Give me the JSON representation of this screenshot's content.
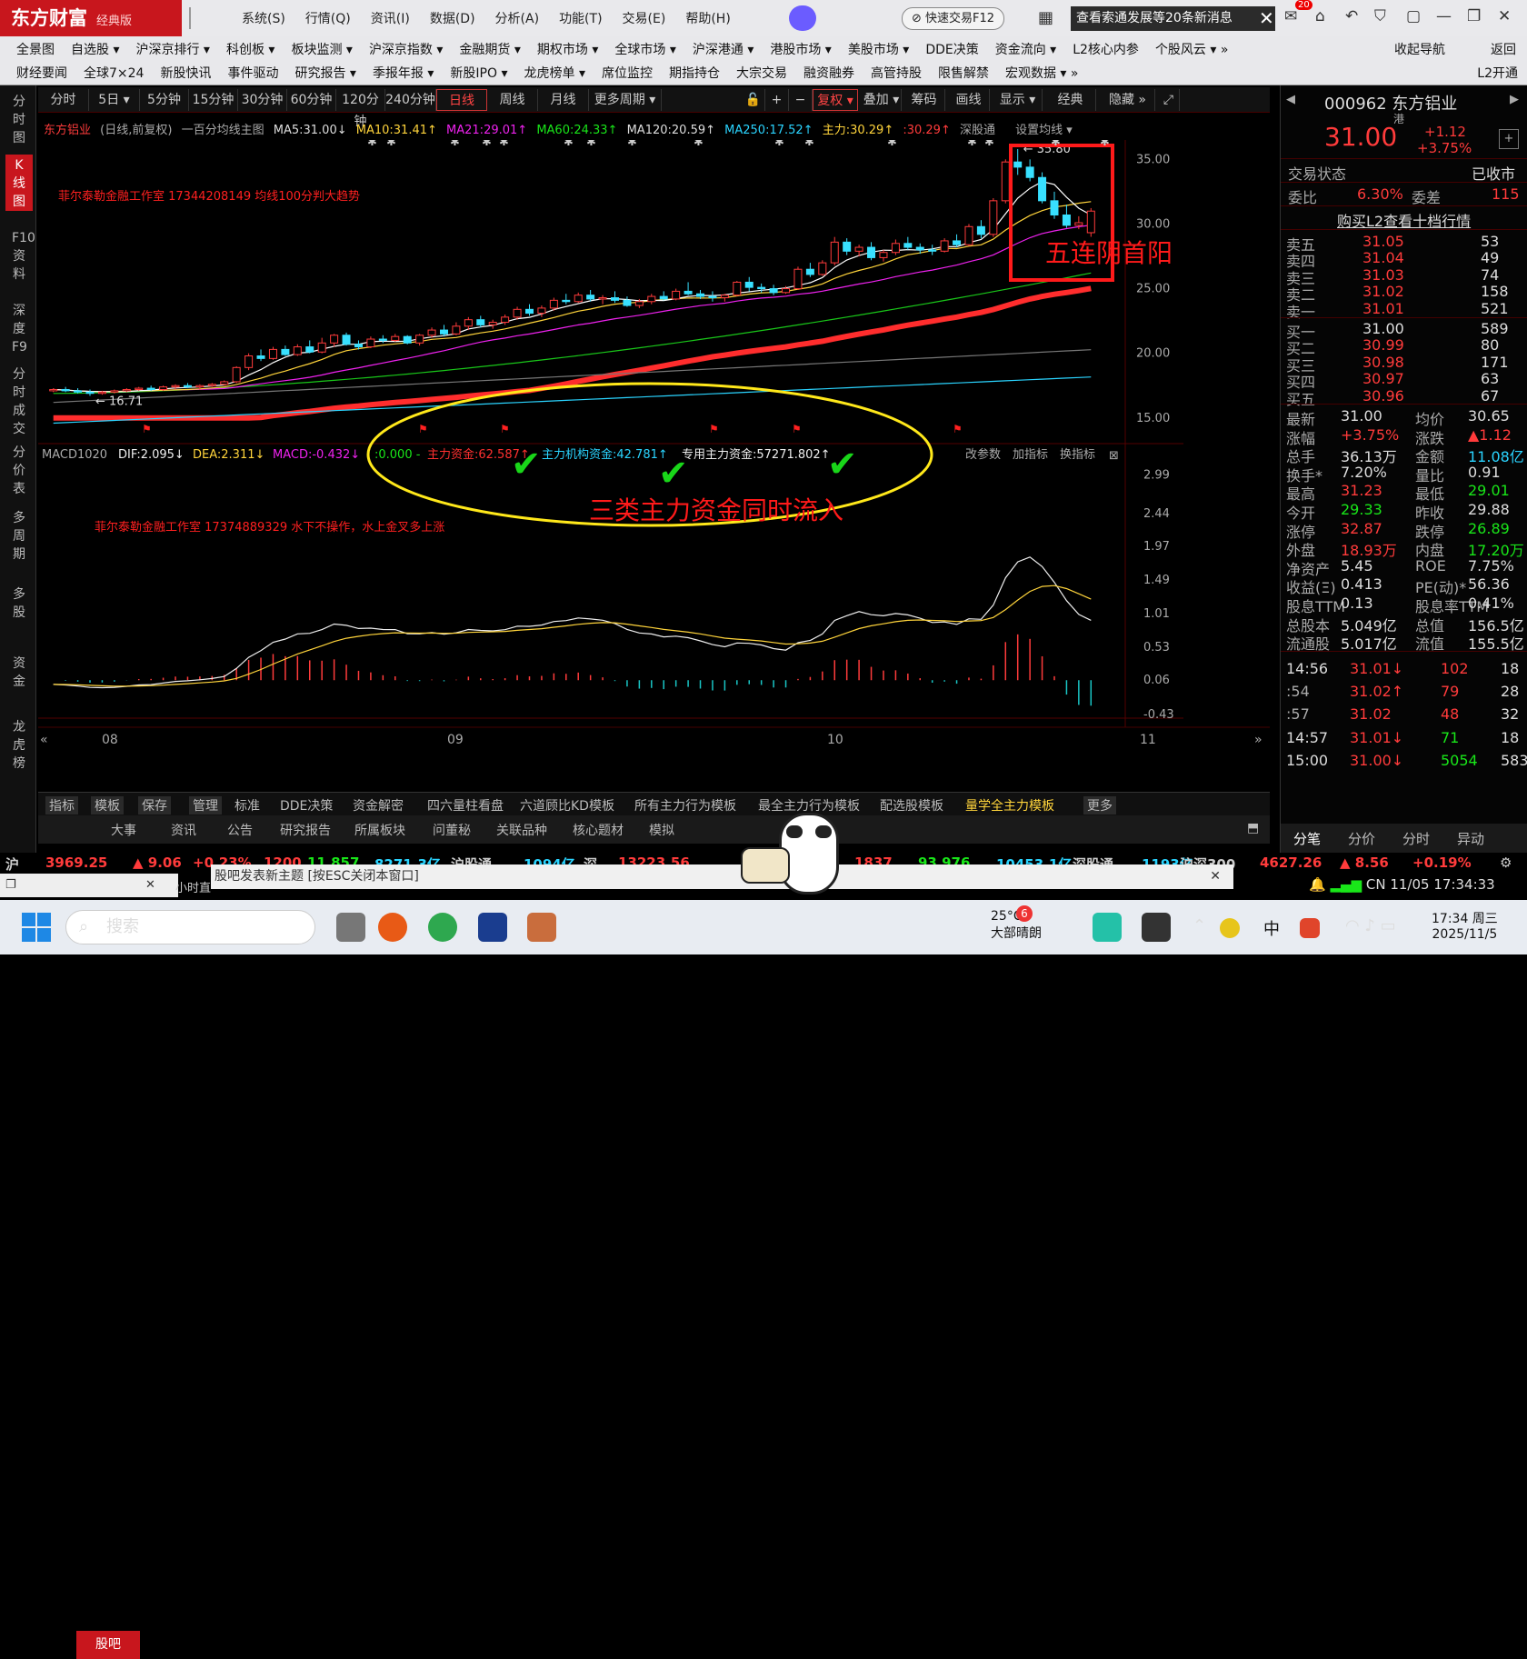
{
  "app": {
    "logo": "东方财富",
    "edition": "经典版"
  },
  "menu": [
    "系统(S)",
    "行情(Q)",
    "资讯(I)",
    "数据(D)",
    "分析(A)",
    "功能(T)",
    "交易(E)",
    "帮助(H)"
  ],
  "fast_trade": "快速交易F12",
  "notice": "查看索通发展等20条新消息",
  "mail_badge": "20",
  "nav1": [
    "全景图",
    "自选股 ▾",
    "沪深京排行 ▾",
    "科创板 ▾",
    "板块监测 ▾",
    "沪深京指数 ▾",
    "金融期货 ▾",
    "期权市场 ▾",
    "全球市场 ▾",
    "沪深港通 ▾",
    "港股市场 ▾",
    "美股市场 ▾",
    "DDE决策",
    "资金流向 ▾",
    "L2核心内参",
    "个股风云 ▾ »"
  ],
  "nav1_right": [
    "收起导航",
    "返回"
  ],
  "nav2": [
    "财经要闻",
    "全球7×24",
    "新股快讯",
    "事件驱动",
    "研究报告 ▾",
    "季报年报 ▾",
    "新股IPO ▾",
    "龙虎榜单 ▾",
    "席位监控",
    "期指持仓",
    "大宗交易",
    "融资融券",
    "高管持股",
    "限售解禁",
    "宏观数据 ▾ »"
  ],
  "nav2_right": "L2开通",
  "left_tabs": [
    "分时图",
    "K线图",
    "F10资料",
    "深度F9",
    "分时成交",
    "分价表",
    "多周期",
    "多股",
    "资金",
    "龙虎榜"
  ],
  "periods": [
    "分时",
    "5日 ▾",
    "5分钟",
    "15分钟",
    "30分钟",
    "60分钟",
    "120分钟",
    "240分钟",
    "日线",
    "周线",
    "月线",
    "更多周期 ▾"
  ],
  "tools": [
    "复权 ▾",
    "叠加 ▾",
    "筹码",
    "画线",
    "显示 ▾",
    "经典",
    "隐藏 »"
  ],
  "info": {
    "name": "东方铝业",
    "mode": "(日线,前复权)",
    "main": "一百分均线主图",
    "ma5": "MA5:31.00↓",
    "ma10": "MA10:31.41↑",
    "ma21": "MA21:29.01↑",
    "ma60": "MA60:24.33↑",
    "ma120": "MA120:20.59↑",
    "ma250": "MA250:17.52↑",
    "zl1": "主力:30.29↑",
    "zl2": ":30.29↑",
    "link": "深股通",
    "set": "设置均线 ▾"
  },
  "annot": {
    "top": "菲尔泰勒金融工作室 17344208149 均线100分判大趋势",
    "five": "五连阴首阳",
    "max": "35.80",
    "min": "16.71",
    "macd_note": "菲尔泰勒金融工作室 17374889329 水下不操作，水上金叉多上涨",
    "three": "三类主力资金同时流入"
  },
  "macd": {
    "name": "MACD1020",
    "dif": "DIF:2.095↓",
    "dea": "DEA:2.311↓",
    "macd": "MACD:-0.432↓",
    "zero": ":0.000 -",
    "f1": "主力资金:62.587↑",
    "f2": "主力机构资金:42.781↑",
    "f3": "专用主力资金:57271.802↑",
    "btns": [
      "改参数",
      "加指标",
      "换指标"
    ]
  },
  "price_axis": [
    "35.00",
    "30.00",
    "25.00",
    "20.00",
    "15.00"
  ],
  "macd_axis": [
    "2.99",
    "2.44",
    "1.97",
    "1.49",
    "1.01",
    "0.53",
    "0.06",
    "-0.43"
  ],
  "months": [
    "08",
    "09",
    "10",
    "11"
  ],
  "bot1": [
    "指标",
    "模板",
    "保存",
    "管理",
    "标准",
    "DDE决策",
    "资金解密",
    "四六量柱看盘",
    "六道顾比KD模板",
    "所有主力行为模板",
    "最全主力行为模板",
    "配选股模板",
    "量学全主力模板",
    "更多"
  ],
  "bot2": [
    "股吧",
    "大事",
    "资讯",
    "公告",
    "研究报告",
    "所属板块",
    "问董秘",
    "关联品种",
    "核心题材",
    "模拟"
  ],
  "right": {
    "code": "000962 东方铝业",
    "hk": "港",
    "price": "31.00",
    "chg": "+1.12",
    "pct": "+3.75%",
    "state_l": "交易状态",
    "state_r": "已收市",
    "wb_l": "委比",
    "wb": "6.30%",
    "wc_l": "委差",
    "wc": "115",
    "l2": "购买L2查看十档行情",
    "sells": [
      [
        "卖五",
        "31.05",
        "53"
      ],
      [
        "卖四",
        "31.04",
        "49"
      ],
      [
        "卖三",
        "31.03",
        "74"
      ],
      [
        "卖二",
        "31.02",
        "158"
      ],
      [
        "卖一",
        "31.01",
        "521"
      ]
    ],
    "buys": [
      [
        "买一",
        "31.00",
        "589"
      ],
      [
        "买二",
        "30.99",
        "80"
      ],
      [
        "买三",
        "30.98",
        "171"
      ],
      [
        "买四",
        "30.97",
        "63"
      ],
      [
        "买五",
        "30.96",
        "67"
      ]
    ],
    "stats": [
      [
        "最新",
        "31.00",
        "均价",
        "30.65"
      ],
      [
        "涨幅",
        "+3.75%",
        "涨跌",
        "▲1.12"
      ],
      [
        "总手",
        "36.13万",
        "金额",
        "11.08亿"
      ],
      [
        "换手*",
        "7.20%",
        "量比",
        "0.91"
      ],
      [
        "最高",
        "31.23",
        "最低",
        "29.01"
      ],
      [
        "今开",
        "29.33",
        "昨收",
        "29.88"
      ],
      [
        "涨停",
        "32.87",
        "跌停",
        "26.89"
      ],
      [
        "外盘",
        "18.93万",
        "内盘",
        "17.20万"
      ],
      [
        "净资产",
        "5.45",
        "ROE",
        "7.75%"
      ],
      [
        "收益(Ξ)",
        "0.413",
        "PE(动)*",
        "56.36"
      ],
      [
        "股息TTM",
        "0.13",
        "股息率TTM",
        "0.41%"
      ],
      [
        "总股本",
        "5.049亿",
        "总值",
        "156.5亿"
      ],
      [
        "流通股",
        "5.017亿",
        "流值",
        "155.5亿"
      ]
    ],
    "ticks": [
      [
        "14:56",
        "31.01↓",
        "102",
        "18"
      ],
      [
        ":54",
        "31.02↑",
        "79",
        "28"
      ],
      [
        ":57",
        "31.02",
        "48",
        "32"
      ],
      [
        "14:57",
        "31.01↓",
        "71",
        "18"
      ],
      [
        "15:00",
        "31.00↓",
        "5054",
        "583"
      ]
    ],
    "tabs": [
      "分笔",
      "分价",
      "分时",
      "异动"
    ]
  },
  "status": {
    "sh": "沪",
    "idx": "3969.25",
    "ch": "▲ 9.06",
    "pct": "+0.23%",
    "v1": "1200",
    "v2": "11 857",
    "v3": "8271.3亿",
    "hgt": "沪股通",
    "hgtv": "1094亿",
    "sz": "深",
    "szi": "13223.56",
    "s1": "1837",
    "s2": "93 976",
    "s3": "10453.1亿",
    "sgt": "深股通",
    "sgtv": "1193亿",
    "hs": "沪深300",
    "hsi": "4627.26",
    "hsc": "▲ 8.56",
    "hsp": "+0.19%",
    "cn": "CN",
    "date": "11/05",
    "time": "17:34:33"
  },
  "postbar": "股吧发表新主题 [按ESC关闭本窗口]",
  "minibar": "小时直",
  "taskbar": {
    "search": "搜索",
    "weather": "25°C",
    "weather2": "大部晴朗",
    "badge": "6",
    "ime": "中",
    "clock": "17:34 周三",
    "date": "2025/11/5"
  },
  "chart_data": {
    "type": "candlestick",
    "title": "东方铝业",
    "period": "日线",
    "ylim": [
      14,
      36.5
    ],
    "x": [
      "08",
      "09",
      "10",
      "11"
    ],
    "ohlc": [
      [
        17.1,
        17.3,
        17.0,
        17.2
      ],
      [
        17.2,
        17.4,
        17.0,
        17.1
      ],
      [
        17.1,
        17.3,
        16.9,
        17.0
      ],
      [
        17.0,
        17.2,
        16.71,
        16.9
      ],
      [
        16.9,
        17.1,
        16.8,
        17.0
      ],
      [
        17.0,
        17.2,
        16.9,
        17.1
      ],
      [
        17.1,
        17.3,
        17.0,
        17.2
      ],
      [
        17.2,
        17.4,
        17.1,
        17.3
      ],
      [
        17.3,
        17.5,
        17.1,
        17.2
      ],
      [
        17.2,
        17.5,
        17.1,
        17.4
      ],
      [
        17.4,
        17.6,
        17.2,
        17.5
      ],
      [
        17.5,
        17.7,
        17.3,
        17.4
      ],
      [
        17.4,
        17.6,
        17.2,
        17.5
      ],
      [
        17.5,
        17.7,
        17.4,
        17.6
      ],
      [
        17.6,
        17.9,
        17.5,
        17.8
      ],
      [
        17.8,
        19.0,
        17.7,
        18.9
      ],
      [
        18.9,
        20.0,
        18.7,
        19.8
      ],
      [
        19.8,
        20.3,
        19.4,
        19.6
      ],
      [
        19.6,
        20.5,
        19.5,
        20.3
      ],
      [
        20.3,
        20.6,
        19.8,
        19.9
      ],
      [
        19.9,
        20.7,
        19.8,
        20.5
      ],
      [
        20.5,
        21.0,
        20.0,
        20.1
      ],
      [
        20.1,
        21.2,
        20.0,
        20.8
      ],
      [
        20.8,
        21.5,
        20.5,
        21.4
      ],
      [
        21.4,
        21.6,
        20.6,
        20.7
      ],
      [
        20.7,
        21.0,
        20.3,
        20.5
      ],
      [
        20.5,
        21.3,
        20.4,
        21.1
      ],
      [
        21.1,
        21.4,
        20.8,
        21.0
      ],
      [
        21.0,
        21.5,
        20.9,
        21.3
      ],
      [
        21.3,
        21.4,
        20.7,
        20.8
      ],
      [
        20.8,
        21.5,
        20.6,
        21.4
      ],
      [
        21.4,
        22.0,
        21.2,
        21.8
      ],
      [
        21.8,
        22.2,
        21.3,
        21.5
      ],
      [
        21.5,
        22.4,
        21.4,
        22.1
      ],
      [
        22.1,
        22.8,
        21.8,
        22.6
      ],
      [
        22.6,
        22.9,
        22.0,
        22.2
      ],
      [
        22.2,
        22.6,
        21.9,
        22.4
      ],
      [
        22.4,
        23.0,
        22.2,
        22.8
      ],
      [
        22.8,
        23.6,
        22.6,
        23.4
      ],
      [
        23.4,
        23.8,
        22.9,
        23.1
      ],
      [
        23.1,
        23.7,
        22.8,
        23.5
      ],
      [
        23.5,
        24.3,
        23.3,
        24.1
      ],
      [
        24.1,
        24.6,
        23.8,
        24.0
      ],
      [
        24.0,
        24.7,
        23.9,
        24.5
      ],
      [
        24.5,
        24.9,
        24.0,
        24.2
      ],
      [
        24.2,
        24.5,
        23.8,
        24.3
      ],
      [
        24.3,
        24.8,
        23.9,
        24.1
      ],
      [
        24.1,
        24.4,
        23.6,
        23.7
      ],
      [
        23.7,
        24.2,
        23.5,
        24.0
      ],
      [
        24.0,
        24.6,
        23.8,
        24.4
      ],
      [
        24.4,
        24.8,
        24.1,
        24.2
      ],
      [
        24.2,
        25.0,
        24.1,
        24.8
      ],
      [
        24.8,
        25.5,
        24.5,
        24.6
      ],
      [
        24.6,
        24.9,
        24.2,
        24.4
      ],
      [
        24.4,
        24.8,
        24.0,
        24.3
      ],
      [
        24.3,
        24.6,
        24.0,
        24.5
      ],
      [
        24.5,
        25.6,
        24.4,
        25.5
      ],
      [
        25.5,
        25.9,
        24.8,
        25.1
      ],
      [
        25.1,
        25.4,
        24.7,
        25.0
      ],
      [
        25.0,
        25.3,
        24.5,
        24.7
      ],
      [
        24.7,
        25.2,
        24.6,
        25.0
      ],
      [
        25.0,
        26.7,
        24.9,
        26.5
      ],
      [
        26.5,
        27.0,
        25.9,
        26.1
      ],
      [
        26.1,
        27.2,
        26.0,
        27.0
      ],
      [
        27.0,
        29.0,
        26.8,
        28.6
      ],
      [
        28.6,
        28.9,
        27.6,
        27.9
      ],
      [
        27.9,
        28.4,
        27.5,
        28.2
      ],
      [
        28.2,
        28.6,
        27.2,
        27.4
      ],
      [
        27.4,
        28.0,
        27.1,
        27.8
      ],
      [
        27.8,
        28.8,
        27.6,
        28.5
      ],
      [
        28.5,
        29.0,
        28.0,
        28.2
      ],
      [
        28.2,
        28.5,
        27.7,
        28.0
      ],
      [
        28.0,
        28.4,
        27.6,
        27.9
      ],
      [
        27.9,
        28.9,
        27.8,
        28.7
      ],
      [
        28.7,
        29.2,
        28.2,
        28.4
      ],
      [
        28.4,
        30.0,
        28.3,
        29.8
      ],
      [
        29.8,
        30.3,
        28.9,
        29.2
      ],
      [
        29.2,
        32.0,
        29.0,
        31.8
      ],
      [
        31.8,
        35.0,
        31.6,
        34.8
      ],
      [
        34.8,
        35.8,
        33.8,
        34.4
      ],
      [
        34.4,
        35.0,
        33.3,
        33.6
      ],
      [
        33.6,
        34.0,
        31.6,
        31.8
      ],
      [
        31.8,
        32.5,
        30.4,
        30.7
      ],
      [
        30.7,
        31.5,
        29.7,
        29.9
      ],
      [
        29.9,
        30.6,
        29.6,
        30.1
      ],
      [
        29.33,
        31.23,
        29.01,
        31.0
      ]
    ],
    "ma250_label": "MA250:17.52"
  }
}
